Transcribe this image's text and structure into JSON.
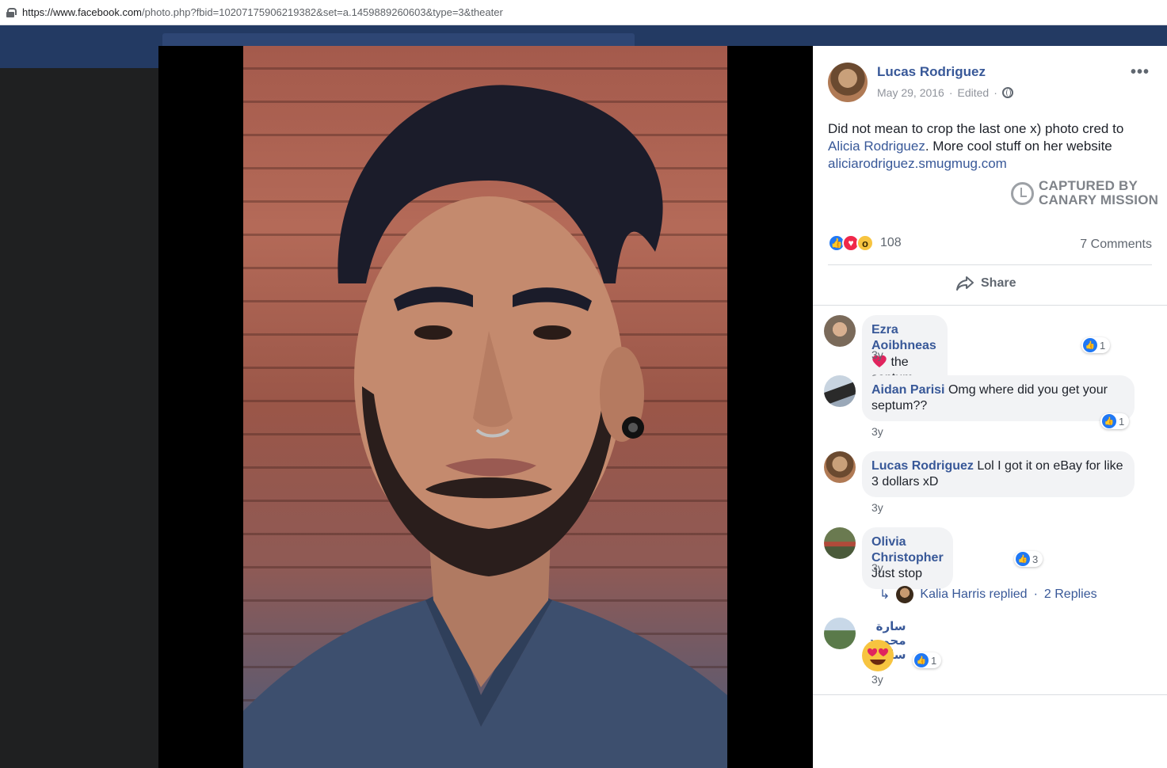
{
  "browser": {
    "url_domain": "https://www.facebook.com",
    "url_rest": "/photo.php?fbid=10207175906219382&set=a.1459889260603&type=3&theater"
  },
  "post": {
    "author": "Lucas Rodriguez",
    "date": "May 29, 2016",
    "edited": "Edited",
    "separator": "·",
    "caption_text_1": "Did not mean to crop the last one x) photo cred to ",
    "caption_link_1": "Alicia Rodriguez",
    "caption_text_2": ". More cool stuff on her website ",
    "caption_link_2": "aliciarodriguez.smugmug.com",
    "reactions_count": "108",
    "comments_count": "7 Comments",
    "share_label": "Share"
  },
  "watermark": {
    "line1": "CAPTURED BY",
    "line2": "CANARY MISSION"
  },
  "comments": [
    {
      "name": "Ezra Aoibhneas",
      "text": "the septum piercing",
      "time": "3y",
      "likes": "1"
    },
    {
      "name": "Aidan Parisi",
      "text": "Omg where did you get your septum??",
      "time": "3y",
      "likes": "1"
    },
    {
      "name": "Lucas Rodriguez",
      "text": "Lol I got it on eBay for like 3 dollars xD",
      "time": "3y"
    },
    {
      "name": "Olivia Christopher",
      "text": "Just stop",
      "time": "3y",
      "likes": "3"
    },
    {
      "name": "سارة محمود سليمان",
      "text": "",
      "time": "3y",
      "likes": "1"
    }
  ],
  "replies": {
    "replier": "Kalia Harris replied",
    "dot": "·",
    "count": "2 Replies"
  },
  "colors": {
    "link": "#385898",
    "like_blue": "#2078f4",
    "love_red": "#f0284a",
    "header_navy": "#233a63"
  },
  "icons": [
    "lock-icon",
    "globe-icon",
    "more-icon",
    "share-icon",
    "like-icon",
    "love-icon",
    "wow-icon",
    "heart-icon",
    "reply-arrow-icon",
    "heart-eyes-emoji"
  ]
}
